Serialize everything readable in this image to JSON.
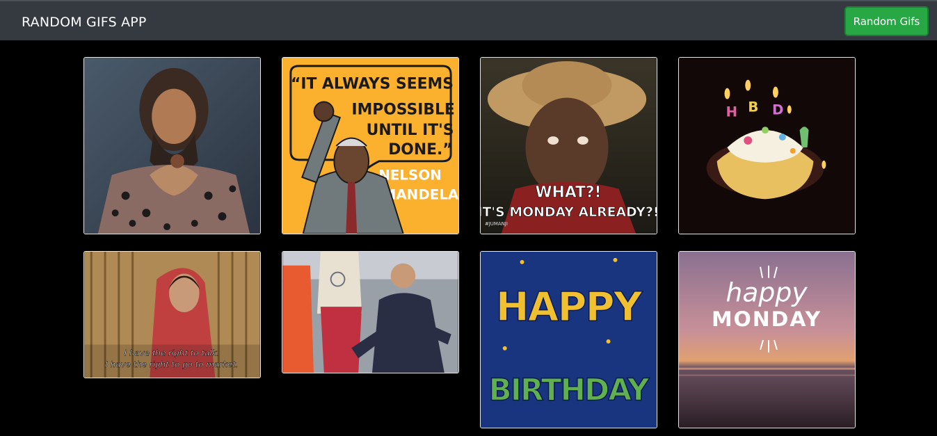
{
  "app": {
    "title": "RANDOM GIFS APP"
  },
  "toolbar": {
    "random_label": "Random Gifs"
  },
  "gifs": [
    {
      "texts": []
    },
    {
      "texts": [
        "“IT ALWAYS SEEMS",
        "IMPOSSIBLE",
        "UNTIL IT'S",
        "DONE.”",
        "NELSON",
        "MANDELA"
      ]
    },
    {
      "texts": [
        "WHAT?!",
        "IT'S MONDAY ALREADY?!",
        "#JUMANJI"
      ]
    },
    {
      "texts": [
        "H",
        "B",
        "D"
      ]
    },
    {
      "texts": [
        "I have the right to talk.",
        "I have the right to go to market."
      ]
    },
    {
      "texts": []
    },
    {
      "texts": [
        "HAPPY",
        "BIRTHDAY"
      ]
    },
    {
      "texts": [
        "happy",
        "MONDAY"
      ]
    }
  ],
  "colors": {
    "navbar": "#343a40",
    "button": "#28a745",
    "background": "#000000"
  }
}
